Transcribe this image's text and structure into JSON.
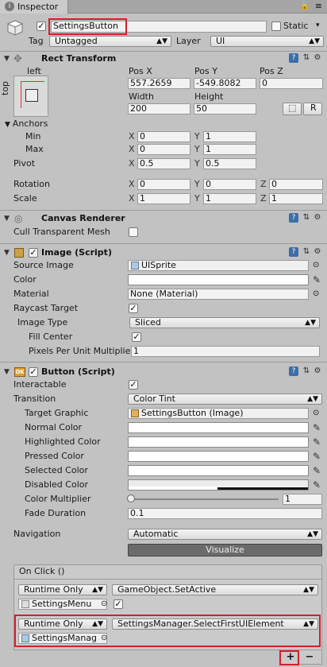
{
  "window": {
    "tab_title": "Inspector"
  },
  "gameobject": {
    "name": "SettingsButton",
    "active": true,
    "static_label": "Static",
    "tag_label": "Tag",
    "tag_value": "Untagged",
    "layer_label": "Layer",
    "layer_value": "UI"
  },
  "rect_transform": {
    "title": "Rect Transform",
    "anchor_h": "left",
    "anchor_v": "top",
    "pos_x_label": "Pos X",
    "pos_y_label": "Pos Y",
    "pos_z_label": "Pos Z",
    "pos_x": "557.2659",
    "pos_y": "-549.8082",
    "pos_z": "0",
    "width_label": "Width",
    "height_label": "Height",
    "width": "200",
    "height": "50",
    "r_button": "R",
    "anchors_label": "Anchors",
    "min_label": "Min",
    "max_label": "Max",
    "min_x": "0",
    "min_y": "1",
    "max_x": "0",
    "max_y": "1",
    "pivot_label": "Pivot",
    "pivot_x": "0.5",
    "pivot_y": "0.5",
    "rotation_label": "Rotation",
    "rot_x": "0",
    "rot_y": "0",
    "rot_z": "0",
    "scale_label": "Scale",
    "scale_x": "1",
    "scale_y": "1",
    "scale_z": "1",
    "x": "X",
    "y": "Y",
    "z": "Z"
  },
  "canvas_renderer": {
    "title": "Canvas Renderer",
    "cull_label": "Cull Transparent Mesh",
    "cull_checked": false
  },
  "image": {
    "title": "Image (Script)",
    "enabled": true,
    "source_label": "Source Image",
    "source_value": "UISprite",
    "color_label": "Color",
    "material_label": "Material",
    "material_value": "None (Material)",
    "raycast_label": "Raycast Target",
    "raycast_checked": true,
    "type_label": "Image Type",
    "type_value": "Sliced",
    "fill_label": "Fill Center",
    "fill_checked": true,
    "ppu_label": "Pixels Per Unit Multiplie",
    "ppu_value": "1"
  },
  "button": {
    "title": "Button (Script)",
    "enabled": true,
    "interactable_label": "Interactable",
    "interactable_checked": true,
    "transition_label": "Transition",
    "transition_value": "Color Tint",
    "target_label": "Target Graphic",
    "target_value": "SettingsButton (Image)",
    "normal_label": "Normal Color",
    "highlighted_label": "Highlighted Color",
    "pressed_label": "Pressed Color",
    "selected_label": "Selected Color",
    "disabled_label": "Disabled Color",
    "multiplier_label": "Color Multiplier",
    "multiplier_value": "1",
    "multiplier_level": 0,
    "fade_label": "Fade Duration",
    "fade_value": "0.1",
    "navigation_label": "Navigation",
    "navigation_value": "Automatic",
    "visualize_label": "Visualize"
  },
  "on_click": {
    "title": "On Click ()",
    "entries": [
      {
        "runtime": "Runtime Only",
        "function": "GameObject.SetActive",
        "object": "SettingsMenu",
        "arg_checked": true
      },
      {
        "runtime": "Runtime Only",
        "function": "SettingsManager.SelectFirstUIElement",
        "object": "SettingsManag"
      }
    ],
    "add": "+",
    "remove": "−"
  },
  "colors": {
    "highlight_red": "#d51e2c",
    "panel_bg": "#c2c2c2",
    "visualize_bg": "#6b6b6b"
  }
}
